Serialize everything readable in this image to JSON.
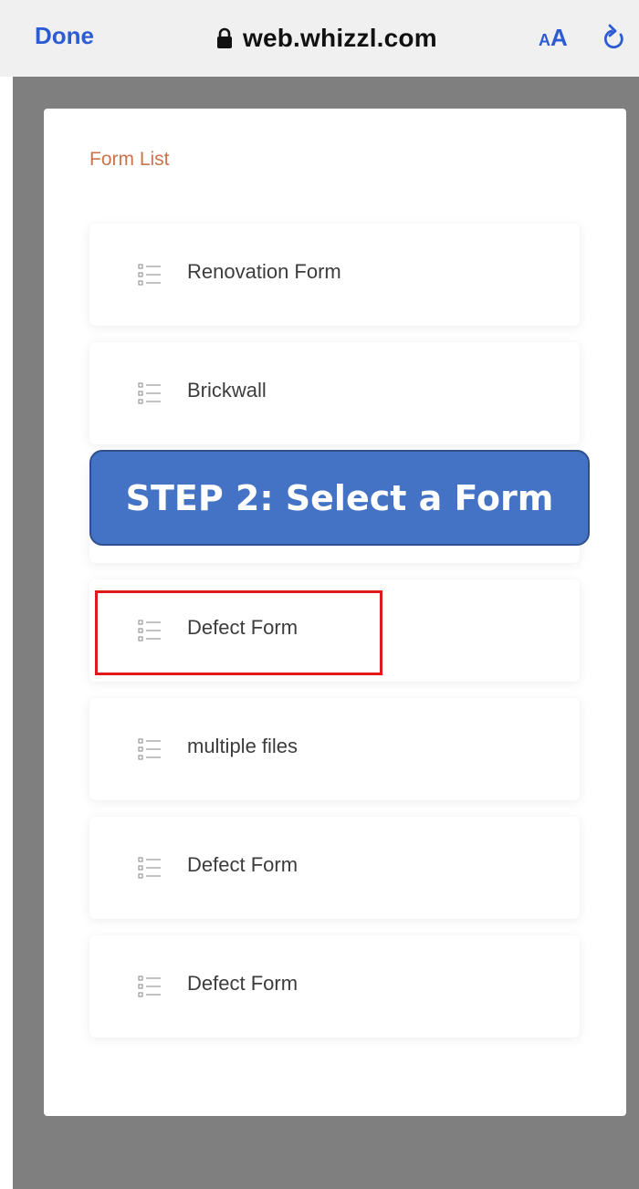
{
  "browser": {
    "done_label": "Done",
    "url": "web.whizzl.com",
    "text_size_small": "A",
    "text_size_large": "A",
    "lock_icon": "lock-icon",
    "reload_icon": "reload-icon"
  },
  "form_list": {
    "title": "Form List",
    "items": [
      {
        "label": "Renovation Form",
        "icon": "list-icon"
      },
      {
        "label": "Brickwall",
        "icon": "list-icon"
      },
      {
        "label": "",
        "icon": "list-icon"
      },
      {
        "label": "Defect Form",
        "icon": "list-icon"
      },
      {
        "label": "multiple files",
        "icon": "list-icon"
      },
      {
        "label": "Defect Form",
        "icon": "list-icon"
      },
      {
        "label": "Defect Form",
        "icon": "list-icon"
      }
    ]
  },
  "annotation": {
    "step_text": "STEP 2: Select a Form",
    "highlight_color": "#e01a1a",
    "banner_color": "#4472c4"
  },
  "colors": {
    "accent": "#2d5bd2",
    "title": "#c9744a",
    "background_grey": "#7f7f7f"
  }
}
